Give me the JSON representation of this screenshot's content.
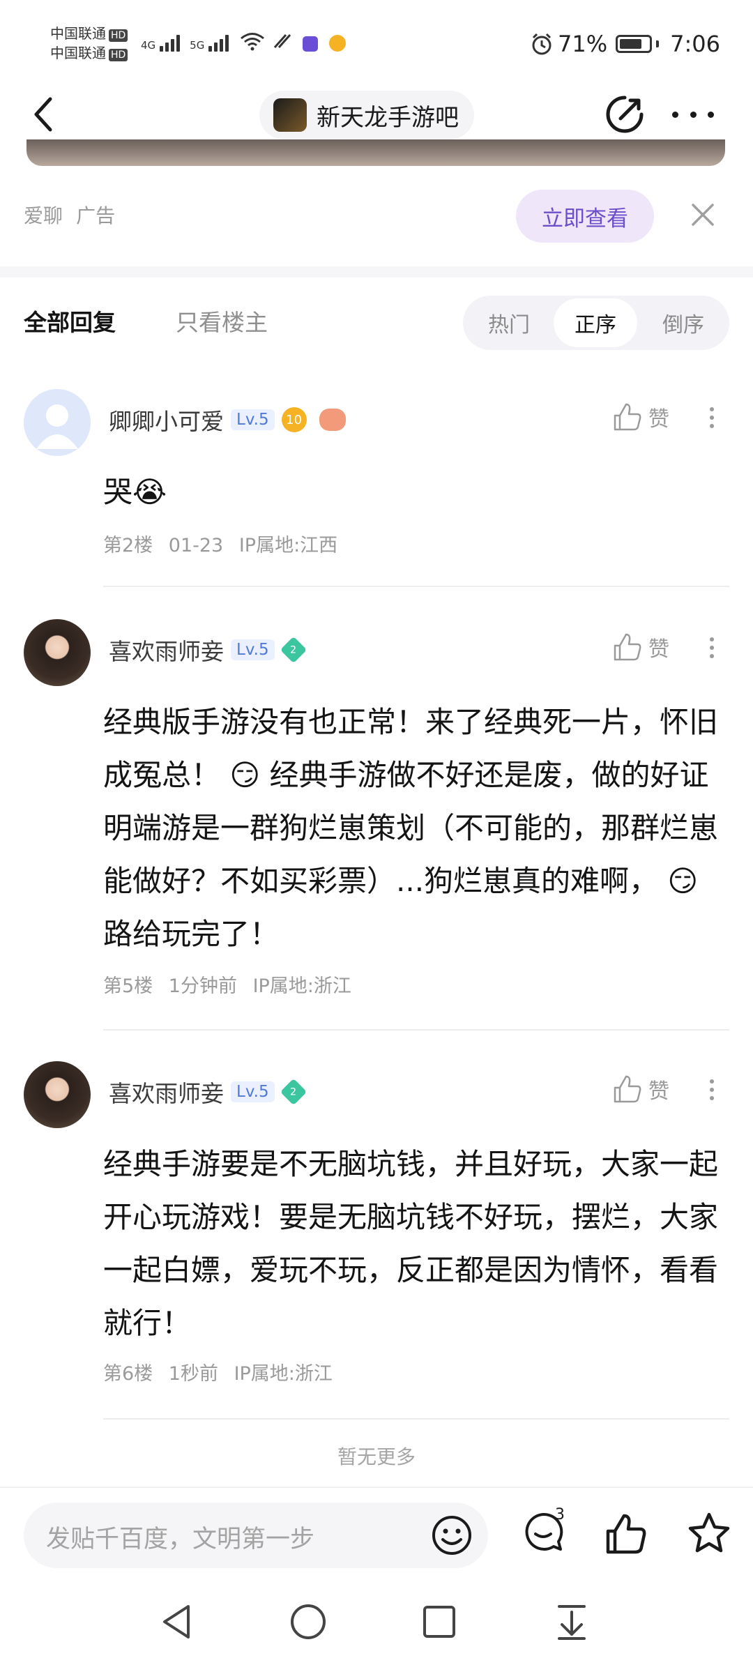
{
  "status_bar": {
    "carrier_1": "中国联通",
    "carrier_2": "中国联通",
    "hd": "HD",
    "net_1": "4G",
    "net_2": "5G",
    "battery": "71%",
    "time": "7:06"
  },
  "header": {
    "forum_name": "新天龙手游吧"
  },
  "ad": {
    "source": "爱聊",
    "label": "广告",
    "cta": "立即查看"
  },
  "tabs": {
    "all_replies": "全部回复",
    "op_only": "只看楼主",
    "sort": [
      "热门",
      "正序",
      "倒序"
    ],
    "sort_active": "正序"
  },
  "posts": [
    {
      "username": "卿卿小可爱",
      "level": "Lv.5",
      "badge": "10",
      "like_label": "赞",
      "content": "哭😭",
      "floor": "第2楼",
      "time": "01-23",
      "ip": "IP属地:江西"
    },
    {
      "username": "喜欢雨师妾",
      "level": "Lv.5",
      "badge": "2",
      "like_label": "赞",
      "content": "经典版手游没有也正常！来了经典死一片，怀旧成冤总！ 😏 经典手游做不好还是废，做的好证明端游是一群狗烂崽策划（不可能的，那群烂崽能做好？不如买彩票）...狗烂崽真的难啊， 😏 路给玩完了！",
      "floor": "第5楼",
      "time": "1分钟前",
      "ip": "IP属地:浙江"
    },
    {
      "username": "喜欢雨师妾",
      "level": "Lv.5",
      "badge": "2",
      "like_label": "赞",
      "content": "经典手游要是不无脑坑钱，并且好玩，大家一起开心玩游戏！要是无脑坑钱不好玩，摆烂，大家一起白嫖，爱玩不玩，反正都是因为情怀，看看就行！",
      "floor": "第6楼",
      "time": "1秒前",
      "ip": "IP属地:浙江"
    }
  ],
  "no_more": "暂无更多",
  "bottom_bar": {
    "input_placeholder": "发贴千百度，文明第一步",
    "comment_count": "3"
  },
  "icons": {
    "back": "back-icon",
    "share": "share-icon",
    "more": "more-icon",
    "close": "close-icon",
    "like": "thumb-up-icon",
    "emoji": "emoji-icon",
    "comment": "comment-icon",
    "favorite": "star-icon"
  },
  "colors": {
    "accent": "#6b4fc9",
    "accent_bg": "#efe6fa",
    "level_blue": "#4f7bd6"
  }
}
